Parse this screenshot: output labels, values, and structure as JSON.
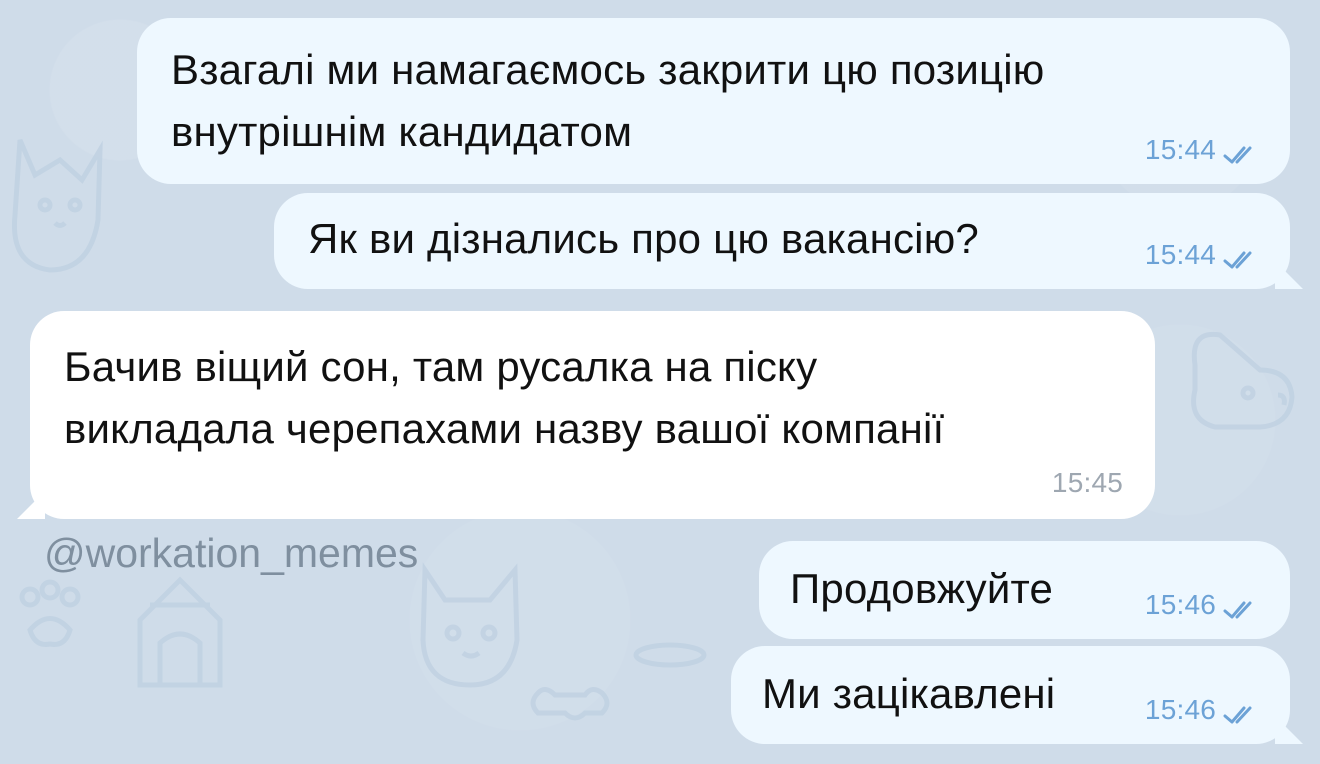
{
  "messages": [
    {
      "text": "Взагалі ми намагаємось закрити цю позицію\nвнутрішнім кандидатом",
      "time": "15:44"
    },
    {
      "text": "Як ви дізнались про цю вакансію?",
      "time": "15:44"
    },
    {
      "text": "Бачив віщий сон, там русалка на піску\nвикладала черепахами назву вашої компанії",
      "time": "15:45"
    },
    {
      "text": "Продовжуйте",
      "time": "15:46"
    },
    {
      "text": "Ми зацікавлені",
      "time": "15:46"
    }
  ],
  "watermark": "@workation_memes",
  "colors": {
    "background": "#cfdce9",
    "outgoing_bubble": "#eef8ff",
    "incoming_bubble": "#ffffff",
    "outgoing_meta": "#6ca2d6",
    "incoming_meta": "#9ea7b1"
  },
  "icons": {
    "read_receipt": "double-check-icon"
  }
}
